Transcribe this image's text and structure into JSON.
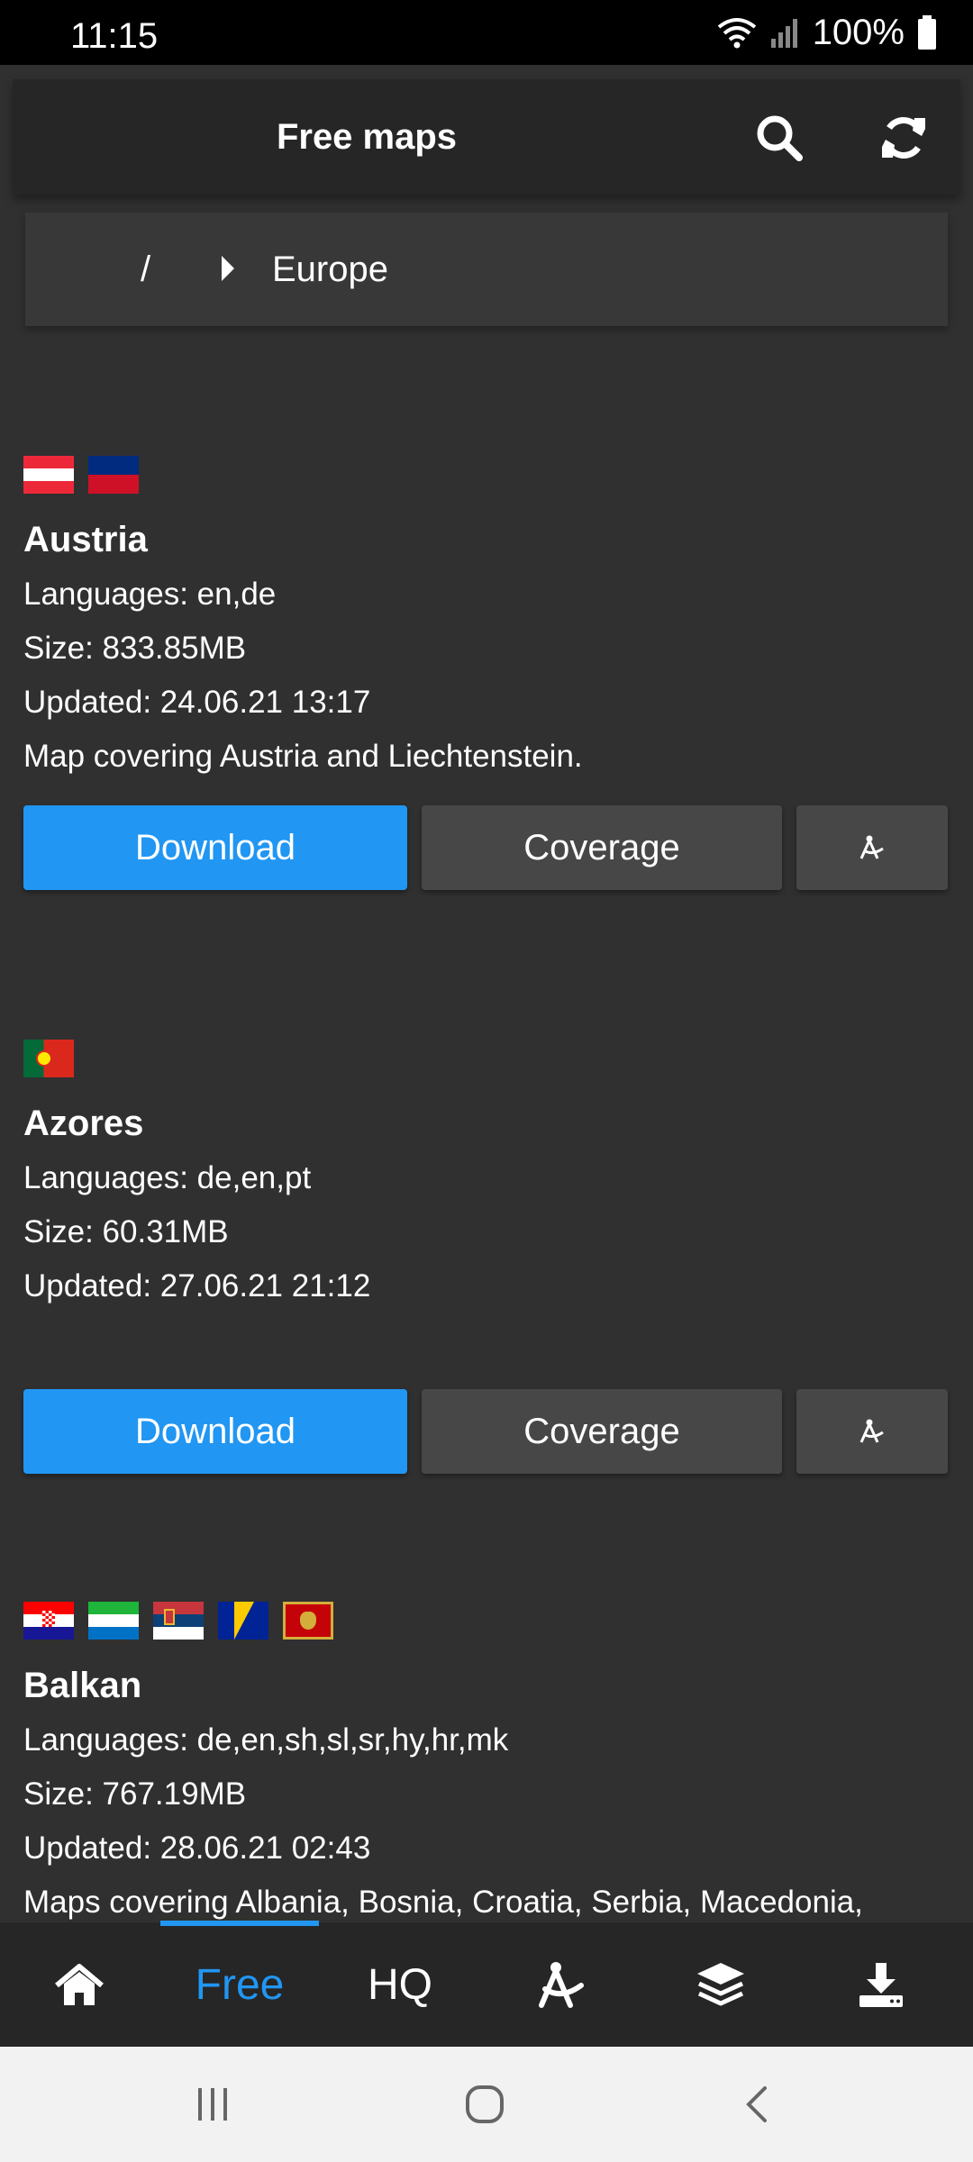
{
  "status_bar": {
    "time": "11:15",
    "battery": "100%"
  },
  "toolbar": {
    "title": "Free maps"
  },
  "breadcrumb": {
    "root": "/",
    "current": "Europe"
  },
  "buttons": {
    "download": "Download",
    "coverage": "Coverage"
  },
  "entries": [
    {
      "name": "Austria",
      "flags": [
        "austria",
        "liechtenstein"
      ],
      "languages": "Languages: en,de",
      "size": "Size: 833.85MB",
      "updated": "Updated: 24.06.21 13:17",
      "description": "Map covering Austria and Liechtenstein."
    },
    {
      "name": "Azores",
      "flags": [
        "portugal"
      ],
      "languages": "Languages: de,en,pt",
      "size": "Size: 60.31MB",
      "updated": "Updated: 27.06.21 21:12",
      "description": ""
    },
    {
      "name": "Balkan",
      "flags": [
        "croatia",
        "sierra-leone",
        "serbia",
        "bosnia",
        "montenegro"
      ],
      "languages": "Languages: de,en,sh,sl,sr,hy,hr,mk",
      "size": "Size: 767.19MB",
      "updated": "Updated: 28.06.21 02:43",
      "description": "Maps covering Albania, Bosnia, Croatia, Serbia, Macedonia,"
    }
  ],
  "tabs": [
    {
      "id": "home",
      "icon": "home-icon"
    },
    {
      "id": "free",
      "label": "Free",
      "active": true
    },
    {
      "id": "hq",
      "label": "HQ"
    },
    {
      "id": "tools",
      "icon": "compass-icon"
    },
    {
      "id": "layers",
      "icon": "layers-icon"
    },
    {
      "id": "downloads",
      "icon": "download-icon"
    }
  ],
  "colors": {
    "accent": "#2196f3",
    "background": "#303030",
    "toolbar": "#262626",
    "button": "#474747"
  }
}
